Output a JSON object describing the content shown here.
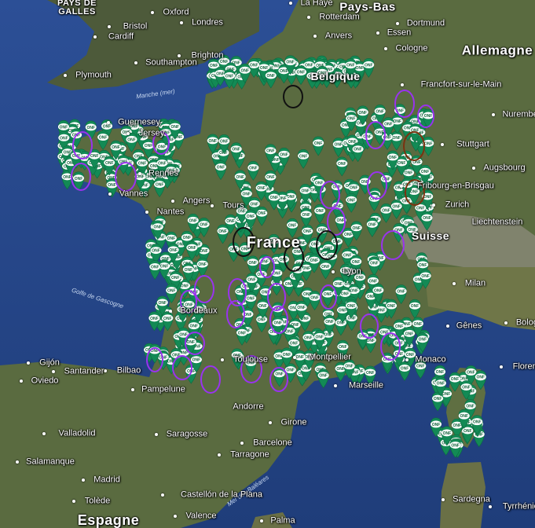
{
  "map": {
    "countries": [
      {
        "id": "pays-de-galles",
        "text": "PAYS DE\nGALLES"
      },
      {
        "id": "pays-bas",
        "text": "Pays-Bas"
      },
      {
        "id": "belgique",
        "text": "Belgique"
      },
      {
        "id": "allemagne",
        "text": "Allemagne"
      },
      {
        "id": "france",
        "text": "France"
      },
      {
        "id": "suisse",
        "text": "Suisse"
      },
      {
        "id": "liechtenstein",
        "text": "Liechtenstein"
      },
      {
        "id": "espagne",
        "text": "Espagne"
      },
      {
        "id": "andorre",
        "text": "Andorre"
      }
    ],
    "cities": [
      "Oxford",
      "Londres",
      "Bristol",
      "Cardiff",
      "Southampton",
      "Brighton",
      "Plymouth",
      "Guernesey",
      "Jersey",
      "La Haye",
      "Rotterdam",
      "Dortmund",
      "Anvers",
      "Essen",
      "Cologne",
      "Francfort-sur-le-Main",
      "Nuremberg",
      "Stuttgart",
      "Augsbourg",
      "Fribourg-en-Brisgau",
      "Zurich",
      "Rennes",
      "Vannes",
      "Nantes",
      "Angers",
      "Tours",
      "Lyon",
      "Milan",
      "Gênes",
      "Bologne",
      "Florence",
      "Marseille",
      "Monaco",
      "Toulouse",
      "Montpellier",
      "Bordeaux",
      "Bilbao",
      "Santander",
      "Gijón",
      "Oviedo",
      "Pampelune",
      "Saragosse",
      "Barcelone",
      "Tarragone",
      "Girone",
      "Valladolid",
      "Salamanque",
      "Madrid",
      "Tolède",
      "Castellón de la Plana",
      "Valence",
      "Palma",
      "Sardegna",
      "Tyrrhénienne"
    ],
    "seas": [
      {
        "id": "manche",
        "text": "Manche (mer)"
      },
      {
        "id": "golfe-gascogne",
        "text": "Golfe de Gascogne"
      },
      {
        "id": "mer-baleares",
        "text": "Mer des Baléares"
      }
    ],
    "marker_label": "ONF"
  }
}
